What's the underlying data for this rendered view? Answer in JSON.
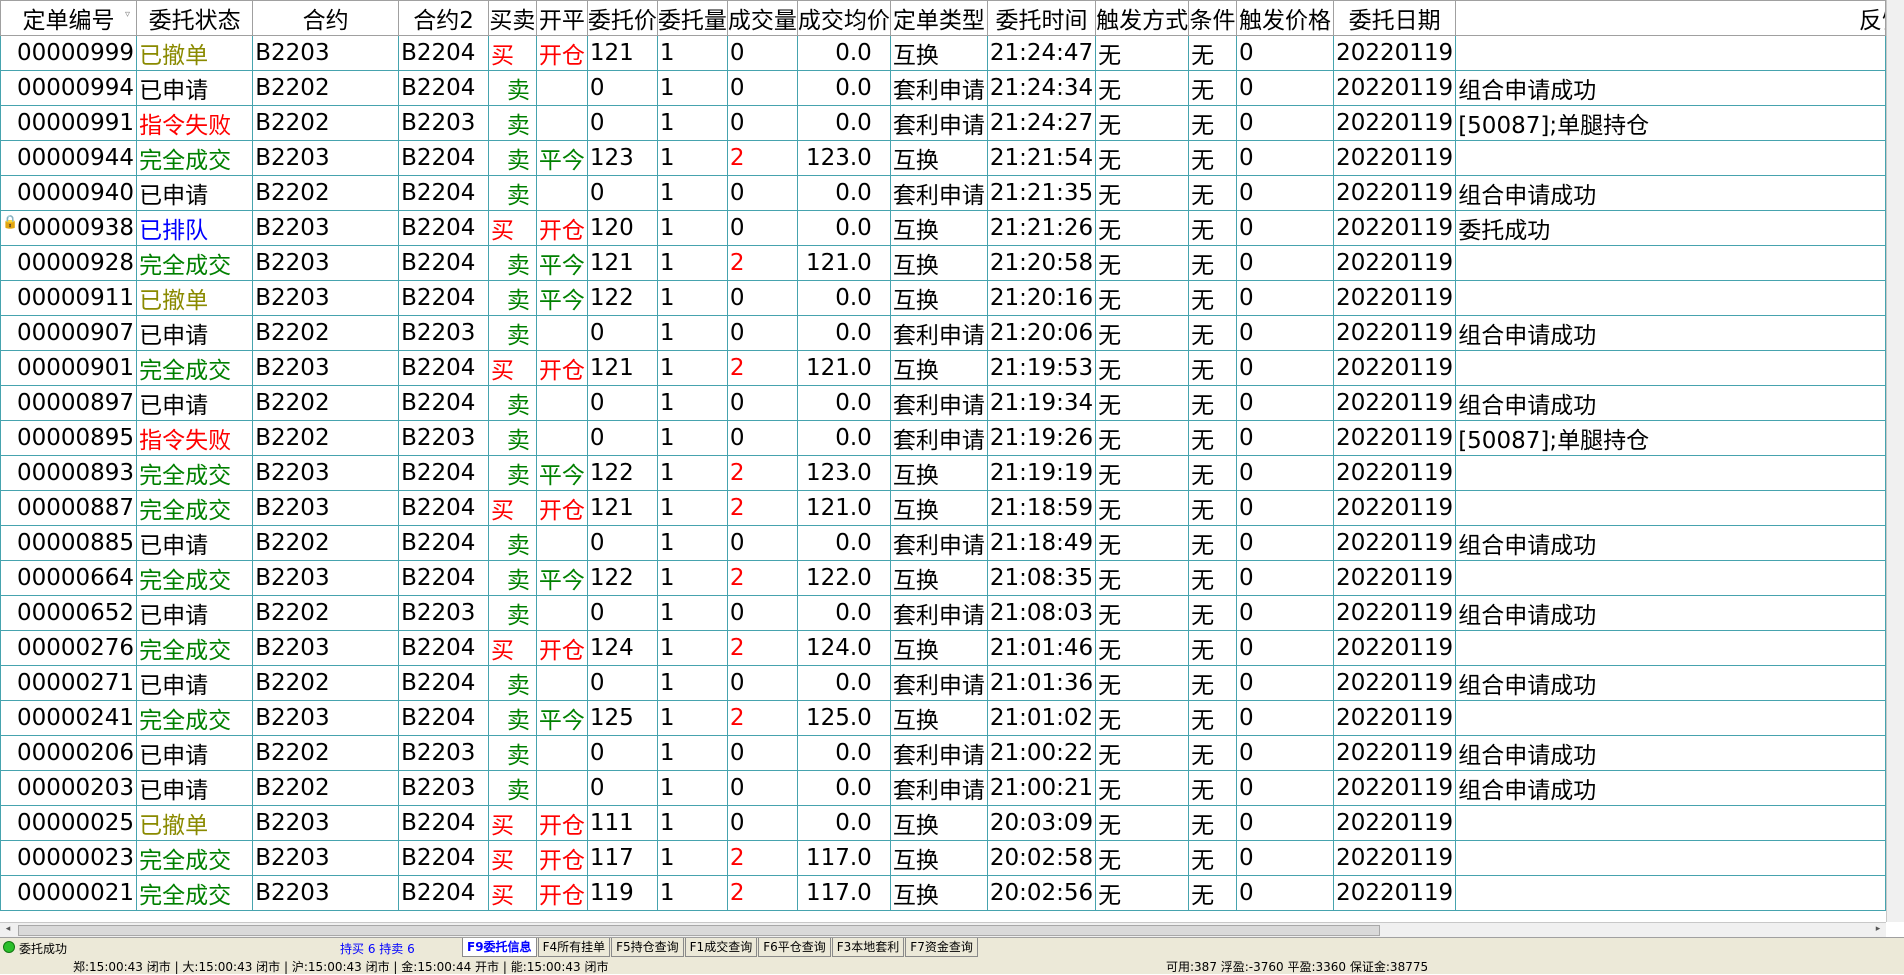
{
  "columns": [
    "定单编号",
    "委托状态",
    "合约",
    "合约2",
    "买卖",
    "开平",
    "委托价",
    "委托量",
    "成交量",
    "成交均价",
    "定单类型",
    "委托时间",
    "触发方式",
    "条件",
    "触发价格",
    "委托日期",
    "反馈"
  ],
  "rows": [
    {
      "id": "00000999",
      "status": "已撤单",
      "st": "canceled",
      "c1": "B2203",
      "c2": "B2204",
      "side": "买",
      "oc": "开仓",
      "price": "121",
      "qty": "1",
      "filled": "0",
      "avg": "0.0",
      "type": "互换",
      "time": "21:24:47",
      "trig": "无",
      "cond": "无",
      "tprice": "0",
      "date": "20220119",
      "fb": ""
    },
    {
      "id": "00000994",
      "status": "已申请",
      "st": "applied",
      "c1": "B2202",
      "c2": "B2204",
      "side": "卖",
      "oc": "",
      "price": "0",
      "qty": "1",
      "filled": "0",
      "avg": "0.0",
      "type": "套利申请",
      "time": "21:24:34",
      "trig": "无",
      "cond": "无",
      "tprice": "0",
      "date": "20220119",
      "fb": "组合申请成功"
    },
    {
      "id": "00000991",
      "status": "指令失败",
      "st": "failed",
      "c1": "B2202",
      "c2": "B2203",
      "side": "卖",
      "oc": "",
      "price": "0",
      "qty": "1",
      "filled": "0",
      "avg": "0.0",
      "type": "套利申请",
      "time": "21:24:27",
      "trig": "无",
      "cond": "无",
      "tprice": "0",
      "date": "20220119",
      "fb": "[50087];单腿持仓"
    },
    {
      "id": "00000944",
      "status": "完全成交",
      "st": "filled",
      "c1": "B2203",
      "c2": "B2204",
      "side": "卖",
      "oc": "平今",
      "price": "123",
      "qty": "1",
      "filled": "2",
      "avg": "123.0",
      "type": "互换",
      "time": "21:21:54",
      "trig": "无",
      "cond": "无",
      "tprice": "0",
      "date": "20220119",
      "fb": ""
    },
    {
      "id": "00000940",
      "status": "已申请",
      "st": "applied",
      "c1": "B2202",
      "c2": "B2204",
      "side": "卖",
      "oc": "",
      "price": "0",
      "qty": "1",
      "filled": "0",
      "avg": "0.0",
      "type": "套利申请",
      "time": "21:21:35",
      "trig": "无",
      "cond": "无",
      "tprice": "0",
      "date": "20220119",
      "fb": "组合申请成功"
    },
    {
      "id": "00000938",
      "status": "已排队",
      "st": "queued",
      "c1": "B2203",
      "c2": "B2204",
      "side": "买",
      "oc": "开仓",
      "price": "120",
      "qty": "1",
      "filled": "0",
      "avg": "0.0",
      "type": "互换",
      "time": "21:21:26",
      "trig": "无",
      "cond": "无",
      "tprice": "0",
      "date": "20220119",
      "fb": "委托成功",
      "lock": true
    },
    {
      "id": "00000928",
      "status": "完全成交",
      "st": "filled",
      "c1": "B2203",
      "c2": "B2204",
      "side": "卖",
      "oc": "平今",
      "price": "121",
      "qty": "1",
      "filled": "2",
      "avg": "121.0",
      "type": "互换",
      "time": "21:20:58",
      "trig": "无",
      "cond": "无",
      "tprice": "0",
      "date": "20220119",
      "fb": ""
    },
    {
      "id": "00000911",
      "status": "已撤单",
      "st": "canceled",
      "c1": "B2203",
      "c2": "B2204",
      "side": "卖",
      "oc": "平今",
      "price": "122",
      "qty": "1",
      "filled": "0",
      "avg": "0.0",
      "type": "互换",
      "time": "21:20:16",
      "trig": "无",
      "cond": "无",
      "tprice": "0",
      "date": "20220119",
      "fb": ""
    },
    {
      "id": "00000907",
      "status": "已申请",
      "st": "applied",
      "c1": "B2202",
      "c2": "B2203",
      "side": "卖",
      "oc": "",
      "price": "0",
      "qty": "1",
      "filled": "0",
      "avg": "0.0",
      "type": "套利申请",
      "time": "21:20:06",
      "trig": "无",
      "cond": "无",
      "tprice": "0",
      "date": "20220119",
      "fb": "组合申请成功"
    },
    {
      "id": "00000901",
      "status": "完全成交",
      "st": "filled",
      "c1": "B2203",
      "c2": "B2204",
      "side": "买",
      "oc": "开仓",
      "price": "121",
      "qty": "1",
      "filled": "2",
      "avg": "121.0",
      "type": "互换",
      "time": "21:19:53",
      "trig": "无",
      "cond": "无",
      "tprice": "0",
      "date": "20220119",
      "fb": ""
    },
    {
      "id": "00000897",
      "status": "已申请",
      "st": "applied",
      "c1": "B2202",
      "c2": "B2204",
      "side": "卖",
      "oc": "",
      "price": "0",
      "qty": "1",
      "filled": "0",
      "avg": "0.0",
      "type": "套利申请",
      "time": "21:19:34",
      "trig": "无",
      "cond": "无",
      "tprice": "0",
      "date": "20220119",
      "fb": "组合申请成功"
    },
    {
      "id": "00000895",
      "status": "指令失败",
      "st": "failed",
      "c1": "B2202",
      "c2": "B2203",
      "side": "卖",
      "oc": "",
      "price": "0",
      "qty": "1",
      "filled": "0",
      "avg": "0.0",
      "type": "套利申请",
      "time": "21:19:26",
      "trig": "无",
      "cond": "无",
      "tprice": "0",
      "date": "20220119",
      "fb": "[50087];单腿持仓"
    },
    {
      "id": "00000893",
      "status": "完全成交",
      "st": "filled",
      "c1": "B2203",
      "c2": "B2204",
      "side": "卖",
      "oc": "平今",
      "price": "122",
      "qty": "1",
      "filled": "2",
      "avg": "123.0",
      "type": "互换",
      "time": "21:19:19",
      "trig": "无",
      "cond": "无",
      "tprice": "0",
      "date": "20220119",
      "fb": ""
    },
    {
      "id": "00000887",
      "status": "完全成交",
      "st": "filled",
      "c1": "B2203",
      "c2": "B2204",
      "side": "买",
      "oc": "开仓",
      "price": "121",
      "qty": "1",
      "filled": "2",
      "avg": "121.0",
      "type": "互换",
      "time": "21:18:59",
      "trig": "无",
      "cond": "无",
      "tprice": "0",
      "date": "20220119",
      "fb": ""
    },
    {
      "id": "00000885",
      "status": "已申请",
      "st": "applied",
      "c1": "B2202",
      "c2": "B2204",
      "side": "卖",
      "oc": "",
      "price": "0",
      "qty": "1",
      "filled": "0",
      "avg": "0.0",
      "type": "套利申请",
      "time": "21:18:49",
      "trig": "无",
      "cond": "无",
      "tprice": "0",
      "date": "20220119",
      "fb": "组合申请成功"
    },
    {
      "id": "00000664",
      "status": "完全成交",
      "st": "filled",
      "c1": "B2203",
      "c2": "B2204",
      "side": "卖",
      "oc": "平今",
      "price": "122",
      "qty": "1",
      "filled": "2",
      "avg": "122.0",
      "type": "互换",
      "time": "21:08:35",
      "trig": "无",
      "cond": "无",
      "tprice": "0",
      "date": "20220119",
      "fb": ""
    },
    {
      "id": "00000652",
      "status": "已申请",
      "st": "applied",
      "c1": "B2202",
      "c2": "B2203",
      "side": "卖",
      "oc": "",
      "price": "0",
      "qty": "1",
      "filled": "0",
      "avg": "0.0",
      "type": "套利申请",
      "time": "21:08:03",
      "trig": "无",
      "cond": "无",
      "tprice": "0",
      "date": "20220119",
      "fb": "组合申请成功"
    },
    {
      "id": "00000276",
      "status": "完全成交",
      "st": "filled",
      "c1": "B2203",
      "c2": "B2204",
      "side": "买",
      "oc": "开仓",
      "price": "124",
      "qty": "1",
      "filled": "2",
      "avg": "124.0",
      "type": "互换",
      "time": "21:01:46",
      "trig": "无",
      "cond": "无",
      "tprice": "0",
      "date": "20220119",
      "fb": ""
    },
    {
      "id": "00000271",
      "status": "已申请",
      "st": "applied",
      "c1": "B2202",
      "c2": "B2204",
      "side": "卖",
      "oc": "",
      "price": "0",
      "qty": "1",
      "filled": "0",
      "avg": "0.0",
      "type": "套利申请",
      "time": "21:01:36",
      "trig": "无",
      "cond": "无",
      "tprice": "0",
      "date": "20220119",
      "fb": "组合申请成功"
    },
    {
      "id": "00000241",
      "status": "完全成交",
      "st": "filled",
      "c1": "B2203",
      "c2": "B2204",
      "side": "卖",
      "oc": "平今",
      "price": "125",
      "qty": "1",
      "filled": "2",
      "avg": "125.0",
      "type": "互换",
      "time": "21:01:02",
      "trig": "无",
      "cond": "无",
      "tprice": "0",
      "date": "20220119",
      "fb": ""
    },
    {
      "id": "00000206",
      "status": "已申请",
      "st": "applied",
      "c1": "B2202",
      "c2": "B2203",
      "side": "卖",
      "oc": "",
      "price": "0",
      "qty": "1",
      "filled": "0",
      "avg": "0.0",
      "type": "套利申请",
      "time": "21:00:22",
      "trig": "无",
      "cond": "无",
      "tprice": "0",
      "date": "20220119",
      "fb": "组合申请成功"
    },
    {
      "id": "00000203",
      "status": "已申请",
      "st": "applied",
      "c1": "B2202",
      "c2": "B2203",
      "side": "卖",
      "oc": "",
      "price": "0",
      "qty": "1",
      "filled": "0",
      "avg": "0.0",
      "type": "套利申请",
      "time": "21:00:21",
      "trig": "无",
      "cond": "无",
      "tprice": "0",
      "date": "20220119",
      "fb": "组合申请成功"
    },
    {
      "id": "00000025",
      "status": "已撤单",
      "st": "canceled",
      "c1": "B2203",
      "c2": "B2204",
      "side": "买",
      "oc": "开仓",
      "price": "111",
      "qty": "1",
      "filled": "0",
      "avg": "0.0",
      "type": "互换",
      "time": "20:03:09",
      "trig": "无",
      "cond": "无",
      "tprice": "0",
      "date": "20220119",
      "fb": ""
    },
    {
      "id": "00000023",
      "status": "完全成交",
      "st": "filled",
      "c1": "B2203",
      "c2": "B2204",
      "side": "买",
      "oc": "开仓",
      "price": "117",
      "qty": "1",
      "filled": "2",
      "avg": "117.0",
      "type": "互换",
      "time": "20:02:58",
      "trig": "无",
      "cond": "无",
      "tprice": "0",
      "date": "20220119",
      "fb": ""
    },
    {
      "id": "00000021",
      "status": "完全成交",
      "st": "filled",
      "c1": "B2203",
      "c2": "B2204",
      "side": "买",
      "oc": "开仓",
      "price": "119",
      "qty": "1",
      "filled": "2",
      "avg": "117.0",
      "type": "互换",
      "time": "20:02:56",
      "trig": "无",
      "cond": "无",
      "tprice": "0",
      "date": "20220119",
      "fb": ""
    }
  ],
  "status": {
    "message": "委托成功",
    "buy_sell": "持买 6  持卖 6",
    "tabs": [
      "F9委托信息",
      "F4所有挂单",
      "F5持仓查询",
      "F1成交查询",
      "F6平仓查询",
      "F3本地套利",
      "F7资金查询"
    ],
    "active_tab": 0,
    "exchange_times": "郑:15:00:43 闭市 | 大:15:00:43 闭市 | 沪:15:00:43 闭市 | 金:15:00:44 开市 | 能:15:00:43 闭市",
    "account": "可用:387 浮盈:-3760 平盈:3360 保证金:38775"
  },
  "colors": {
    "grid_line": "#46a3ae",
    "buy": "#ff0000",
    "sell": "#008000",
    "canceled": "#8a8a00",
    "queued": "#0000ff"
  }
}
